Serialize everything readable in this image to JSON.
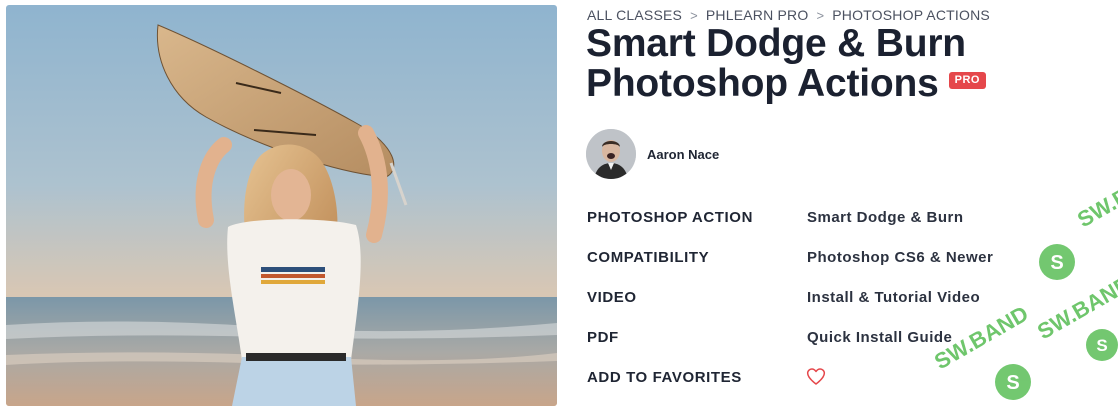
{
  "breadcrumb": [
    {
      "label": "ALL CLASSES"
    },
    {
      "label": "PHLEARN PRO"
    },
    {
      "label": "PHOTOSHOP ACTIONS"
    }
  ],
  "breadcrumb_separator": ">",
  "title_line1": "Smart Dodge & Burn",
  "title_line2": "Photoshop Actions",
  "badge": "PRO",
  "author": {
    "name": "Aaron Nace"
  },
  "details": [
    {
      "label": "PHOTOSHOP ACTION",
      "value": "Smart Dodge & Burn"
    },
    {
      "label": "COMPATIBILITY",
      "value": "Photoshop CS6 & Newer"
    },
    {
      "label": "VIDEO",
      "value": "Install & Tutorial Video"
    },
    {
      "label": "PDF",
      "value": "Quick Install Guide"
    }
  ],
  "favorites": {
    "label": "ADD TO FAVORITES",
    "icon": "heart-icon"
  },
  "watermark": {
    "text": "SW.BAND"
  },
  "colors": {
    "badge": "#e5474b",
    "heart": "#e5474b",
    "watermark": "#4cb848"
  }
}
